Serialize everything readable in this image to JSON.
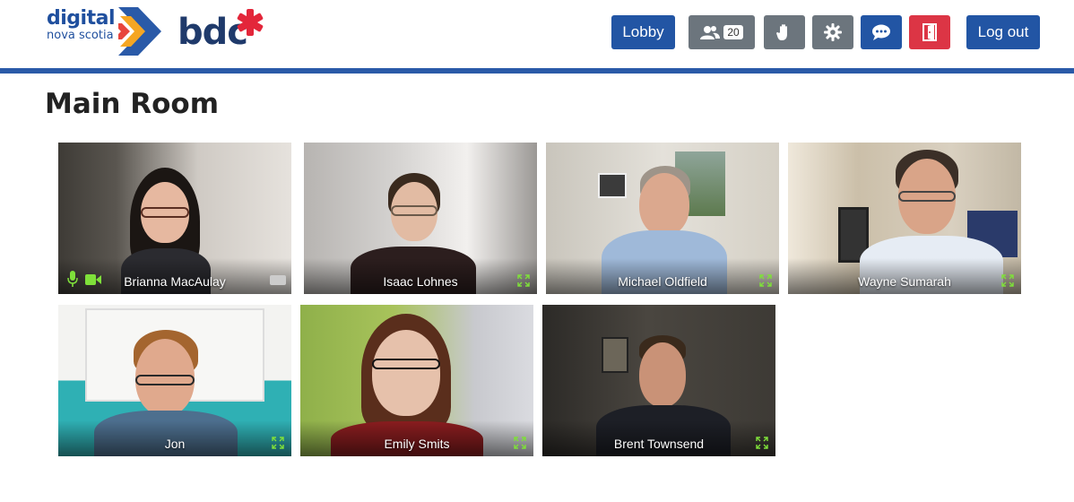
{
  "logos": {
    "dns_line1": "digital",
    "dns_line2": "nova scotia",
    "bdc": "bdc"
  },
  "toolbar": {
    "lobby_label": "Lobby",
    "participants_count": "20",
    "logout_label": "Log out",
    "participants_icon": "users-icon",
    "raise_hand_icon": "hand-icon",
    "settings_icon": "gear-icon",
    "chat_icon": "chat-icon",
    "leave_icon": "door-exit-icon"
  },
  "colors": {
    "primary": "#2255a4",
    "secondary": "#6c757d",
    "danger": "#dc3545",
    "accent_green": "#7fe03a"
  },
  "room": {
    "title": "Main Room"
  },
  "participants": [
    {
      "name": "Brianna MacAulay",
      "mic_on": true,
      "cam_on": true
    },
    {
      "name": "Isaac Lohnes"
    },
    {
      "name": "Michael Oldfield"
    },
    {
      "name": "Wayne Sumarah"
    },
    {
      "name": "Jon"
    },
    {
      "name": "Emily Smits"
    },
    {
      "name": "Brent Townsend"
    }
  ]
}
